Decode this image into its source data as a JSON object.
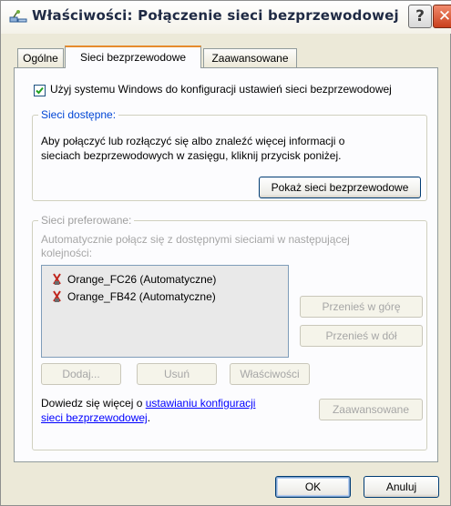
{
  "window": {
    "title": "Właściwości: Połączenie sieci bezprzewodowej",
    "help_glyph": "?",
    "close_glyph": "✕"
  },
  "tabs": [
    {
      "label": "Ogólne",
      "active": false
    },
    {
      "label": "Sieci bezprzewodowe",
      "active": true
    },
    {
      "label": "Zaawansowane",
      "active": false
    }
  ],
  "checkbox": {
    "label": "Użyj systemu Windows do konfiguracji ustawień sieci bezprzewodowej",
    "checked": true
  },
  "available": {
    "legend": "Sieci dostępne:",
    "desc_line1": "Aby połączyć lub rozłączyć się albo znaleźć więcej informacji o",
    "desc_line2": "sieciach bezprzewodowych w zasięgu, kliknij przycisk poniżej.",
    "button": "Pokaż sieci bezprzewodowe"
  },
  "preferred": {
    "legend": "Sieci preferowane:",
    "desc_line1": "Automatycznie połącz się z dostępnymi sieciami w następującej",
    "desc_line2": "kolejności:",
    "networks": [
      {
        "name": "Orange_FC26 (Automatyczne)",
        "icon": "wireless-network-icon"
      },
      {
        "name": "Orange_FB42 (Automatyczne)",
        "icon": "wireless-network-icon"
      }
    ],
    "move_up": "Przenieś w górę",
    "move_down": "Przenieś w dół",
    "add": "Dodaj...",
    "remove": "Usuń",
    "properties": "Właściwości",
    "learn_prefix": "Dowiedz się więcej o ",
    "learn_link_line1": "ustawianiu konfiguracji",
    "learn_link_line2": "sieci bezprzewodowej",
    "learn_suffix": ".",
    "advanced": "Zaawansowane"
  },
  "footer": {
    "ok": "OK",
    "cancel": "Anuluj"
  },
  "colors": {
    "dialog_bg": "#ECE9D8",
    "active_tab_accent": "#E68B2C",
    "legend_blue": "#0046D5",
    "close_red": "#C9401D"
  }
}
